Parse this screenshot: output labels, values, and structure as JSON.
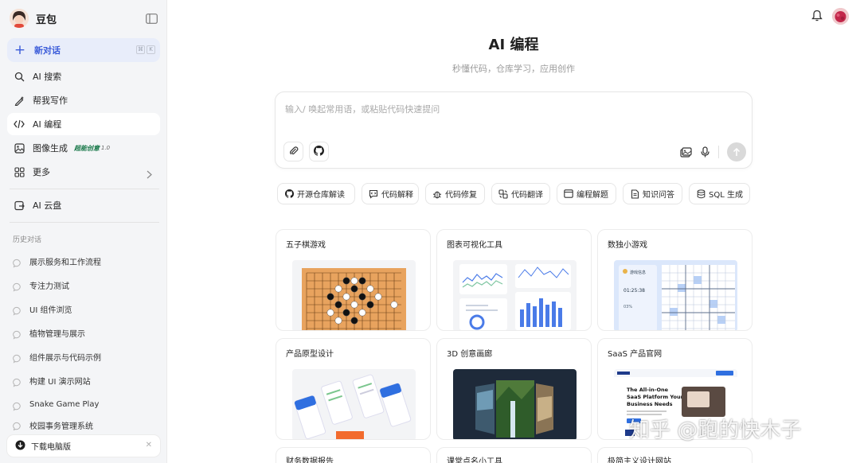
{
  "app": {
    "name": "豆包"
  },
  "sidebar": {
    "new_chat": "新对话",
    "nav": [
      {
        "label": "AI 搜索",
        "icon": "search-icon"
      },
      {
        "label": "帮我写作",
        "icon": "pen-icon"
      },
      {
        "label": "AI 编程",
        "icon": "code-icon",
        "active": true
      },
      {
        "label": "图像生成",
        "icon": "image-icon",
        "badge": "超能创意",
        "badge_version": "1.0"
      },
      {
        "label": "更多",
        "icon": "grid-icon"
      },
      {
        "label": "AI 云盘",
        "icon": "cloud-drive-icon"
      }
    ],
    "history_title": "历史对话",
    "history": [
      "展示服务和工作流程",
      "专注力测试",
      "UI 组件浏览",
      "植物管理与展示",
      "组件展示与代码示例",
      "构建 UI 演示网站",
      "Snake Game Play",
      "校园事务管理系统"
    ],
    "download": "下载电脑版"
  },
  "main": {
    "title": "AI 编程",
    "subtitle": "秒懂代码，仓库学习，应用创作",
    "input_placeholder": "输入/ 唤起常用语，或粘贴代码快速提问",
    "chips": [
      "开源仓库解读",
      "代码解释",
      "代码修复",
      "代码翻译",
      "编程解题",
      "知识问答",
      "SQL 生成"
    ],
    "cards": [
      "五子棋游戏",
      "图表可视化工具",
      "数独小游戏",
      "产品原型设计",
      "3D 创意画廊",
      "SaaS 产品官网",
      "财务数据报告",
      "课堂点名小工具",
      "极简主义设计网站"
    ],
    "saas_preview": {
      "headline_1": "The All-in-One",
      "headline_2": "SaaS Platform Your",
      "headline_3": "Business Needs"
    },
    "sudoku_preview": {
      "label": "游戏信息",
      "timer": "01:25:38",
      "progress": "03%"
    }
  },
  "watermark": "知乎 @跑的快木子",
  "colors": {
    "accent": "#3a5bd9",
    "sidebar_bg": "#f4f5f7"
  }
}
